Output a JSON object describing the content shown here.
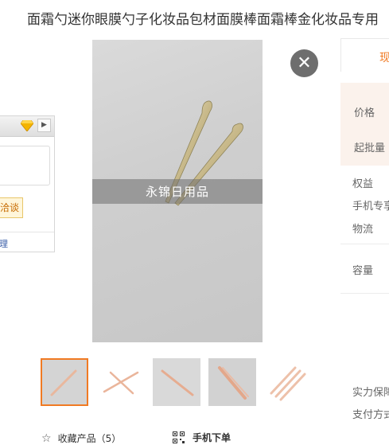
{
  "title": "面霜勺迷你眼膜勺子化妆品包材面膜棒面霜棒金化妆品专用",
  "chat_widget": {
    "negotiate_label": "洽谈",
    "footer_link": "理"
  },
  "main_image": {
    "watermark": "永锦日用品",
    "close_glyph": "✕"
  },
  "thumbnails": [
    {
      "name": "thumb-1",
      "selected": true
    },
    {
      "name": "thumb-2",
      "selected": false
    },
    {
      "name": "thumb-3",
      "selected": false
    },
    {
      "name": "thumb-4",
      "selected": false
    },
    {
      "name": "thumb-5",
      "selected": false
    }
  ],
  "actions": {
    "collect_label": "收藏产品（5）",
    "mobile_order_label": "手机下单",
    "star_icon": "star-icon",
    "qr_icon": "qr-code-icon"
  },
  "right_panel": {
    "tab_label": "现",
    "price_label": "价格",
    "min_batch_label": "起批量",
    "benefits_label": "权益",
    "mobile_exclusive_label": "手机专享",
    "logistics_label": "物流",
    "capacity_label": "容量",
    "guarantee_label": "实力保障",
    "payment_label": "支付方式"
  },
  "colors": {
    "accent": "#f07a23",
    "price_bg": "#fbf2ec",
    "close_bg": "#6e6e6e"
  }
}
